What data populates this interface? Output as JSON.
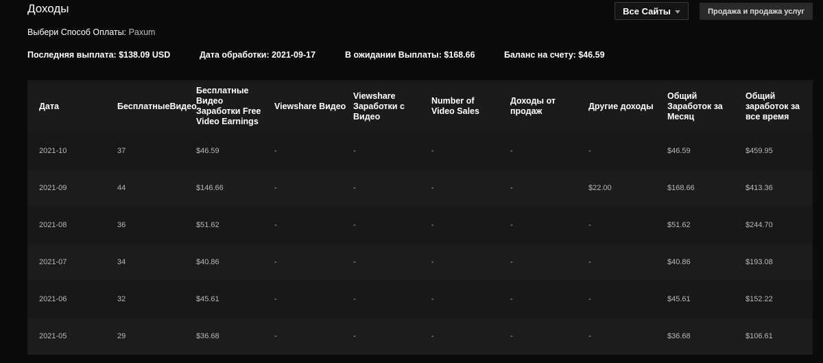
{
  "header": {
    "title": "Доходы",
    "sites_button": "Все Сайты",
    "sales_button": "Продажа и продажа услуг"
  },
  "payment": {
    "label": "Выбери Способ Оплаты:",
    "value": "Paxum"
  },
  "summary": {
    "last_payout": "Последняя выплата: $138.09 USD",
    "processing_date": "Дата обработки: 2021-09-17",
    "pending_payout": "В ожидании Выплаты: $168.66",
    "balance": "Баланс на счету: $46.59"
  },
  "table": {
    "headers": [
      "Дата",
      "БесплатныеВидео",
      "Бесплатные Видео Заработки Free Video Earnings",
      "Viewshare Видео",
      "Viewshare Заработки с Видео",
      "Number of Video Sales",
      "Доходы от продаж",
      "Другие доходы",
      "Общий Заработок за Месяц",
      "Общий заработок за все время"
    ],
    "rows": [
      [
        "2021-10",
        "37",
        "$46.59",
        "-",
        "-",
        "-",
        "-",
        "-",
        "$46.59",
        "$459.95"
      ],
      [
        "2021-09",
        "44",
        "$146.66",
        "-",
        "-",
        "-",
        "-",
        "$22.00",
        "$168.66",
        "$413.36"
      ],
      [
        "2021-08",
        "36",
        "$51.62",
        "-",
        "-",
        "-",
        "-",
        "-",
        "$51.62",
        "$244.70"
      ],
      [
        "2021-07",
        "34",
        "$40.86",
        "-",
        "-",
        "-",
        "-",
        "-",
        "$40.86",
        "$193.08"
      ],
      [
        "2021-06",
        "32",
        "$45.61",
        "-",
        "-",
        "-",
        "-",
        "-",
        "$45.61",
        "$152.22"
      ],
      [
        "2021-05",
        "29",
        "$36.68",
        "-",
        "-",
        "-",
        "-",
        "-",
        "$36.68",
        "$106.61"
      ]
    ]
  }
}
